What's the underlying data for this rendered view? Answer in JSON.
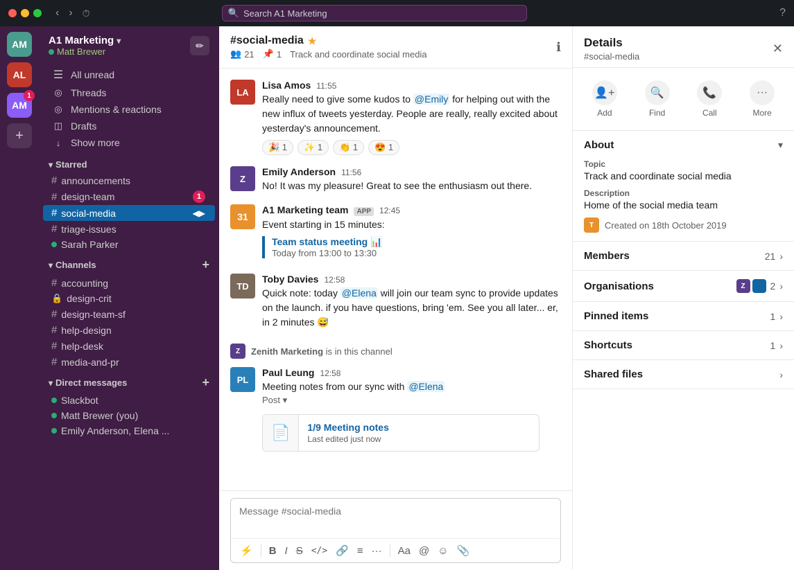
{
  "titleBar": {
    "searchPlaceholder": "Search A1 Marketing",
    "backBtn": "‹",
    "forwardBtn": "›"
  },
  "activityBar": {
    "workspaceInitials": "AM",
    "secondInitials": "AL",
    "thirdInitials": "AM",
    "badgeCount": "1"
  },
  "sidebar": {
    "workspaceName": "A1 Marketing",
    "userName": "Matt Brewer",
    "navItems": [
      {
        "id": "all-unread",
        "label": "All unread",
        "icon": "☰"
      },
      {
        "id": "threads",
        "label": "Threads",
        "icon": "○"
      },
      {
        "id": "mentions",
        "label": "Mentions & reactions",
        "icon": "○"
      },
      {
        "id": "drafts",
        "label": "Drafts",
        "icon": "◫"
      },
      {
        "id": "show-more",
        "label": "Show more",
        "icon": "↓"
      }
    ],
    "starred": {
      "title": "Starred",
      "items": [
        {
          "id": "announcements",
          "label": "announcements",
          "prefix": "#"
        },
        {
          "id": "design-team",
          "label": "design-team",
          "prefix": "#",
          "badge": "1"
        },
        {
          "id": "social-media",
          "label": "social-media",
          "prefix": "#",
          "active": true
        }
      ]
    },
    "channels": {
      "title": "Channels",
      "items": [
        {
          "id": "accounting",
          "label": "accounting",
          "prefix": "#"
        },
        {
          "id": "design-crit",
          "label": "design-crit",
          "prefix": "🔒",
          "lock": true
        },
        {
          "id": "design-team-sf",
          "label": "design-team-sf",
          "prefix": "#"
        },
        {
          "id": "help-design",
          "label": "help-design",
          "prefix": "#"
        },
        {
          "id": "help-desk",
          "label": "help-desk",
          "prefix": "#"
        },
        {
          "id": "media-and-pr",
          "label": "media-and-pr",
          "prefix": "#"
        }
      ]
    },
    "dms": {
      "title": "Direct messages",
      "items": [
        {
          "id": "slackbot",
          "label": "Slackbot",
          "status": "online"
        },
        {
          "id": "matt",
          "label": "Matt Brewer (you)",
          "status": "online"
        },
        {
          "id": "emily-elena",
          "label": "Emily Anderson, Elena ...",
          "status": "online"
        }
      ]
    },
    "extraItem": {
      "label": "Sarah Parker",
      "status": "online"
    }
  },
  "chat": {
    "channelName": "#social-media",
    "memberCount": "21",
    "pinCount": "1",
    "description": "Track and coordinate social media",
    "messages": [
      {
        "id": "msg1",
        "sender": "Lisa Amos",
        "time": "11:55",
        "avatarColor": "#c0392b",
        "avatarInitials": "LA",
        "text": "Really need to give some kudos to @Emily for helping out with the new influx of tweets yesterday. People are really, really excited about yesterday's announcement.",
        "mention": "@Emily",
        "reactions": [
          {
            "emoji": "🎉",
            "count": "1"
          },
          {
            "emoji": "✨",
            "count": "1"
          },
          {
            "emoji": "👏",
            "count": "1"
          },
          {
            "emoji": "😍",
            "count": "1"
          }
        ]
      },
      {
        "id": "msg2",
        "sender": "Emily Anderson",
        "time": "11:56",
        "avatarColor": "#5a3e8b",
        "avatarInitials": "Z",
        "text": "No! It was my pleasure! Great to see the enthusiasm out there."
      },
      {
        "id": "msg3",
        "sender": "A1 Marketing team",
        "time": "12:45",
        "isApp": true,
        "avatarNum": "31",
        "text": "Event starting in 15 minutes:",
        "quote": {
          "title": "Team status meeting 📊",
          "text": "Today from 13:00 to 13:30"
        }
      },
      {
        "id": "msg4",
        "sender": "Toby Davies",
        "time": "12:58",
        "avatarColor": "#7a6a5a",
        "avatarInitials": "TD",
        "text": "Quick note: today @Elena will join our team sync to provide updates on the launch. if you have questions, bring 'em. See you all later... er, in 2 minutes 😅",
        "mention": "@Elena"
      },
      {
        "id": "msg5",
        "sender": "Paul Leung",
        "time": "12:58",
        "avatarColor": "#2980b9",
        "avatarInitials": "PL",
        "text": "Meeting notes from our sync with @Elena",
        "mention": "@Elena",
        "postLabel": "Post",
        "post": {
          "title": "1/9 Meeting notes",
          "meta": "Last edited just now"
        }
      }
    ],
    "systemMsg": {
      "text": "Zenith Marketing is in this channel",
      "avatarLabel": "Z"
    },
    "inputPlaceholder": "Message #social-media",
    "toolbarButtons": [
      "⚡",
      "B",
      "I",
      "S",
      "</>",
      "🔗",
      "≡",
      "···",
      "Aa",
      "@",
      "☺",
      "📎"
    ]
  },
  "details": {
    "title": "Details",
    "subtitle": "#social-media",
    "actions": [
      {
        "id": "add",
        "label": "Add",
        "icon": "👤+"
      },
      {
        "id": "find",
        "label": "Find",
        "icon": "🔍"
      },
      {
        "id": "call",
        "label": "Call",
        "icon": "📞"
      },
      {
        "id": "more",
        "label": "More",
        "icon": "···"
      }
    ],
    "about": {
      "title": "About",
      "topic": {
        "label": "Topic",
        "value": "Track and coordinate social media"
      },
      "description": {
        "label": "Description",
        "value": "Home of the social media team"
      },
      "createdDate": "Created on 18th October 2019"
    },
    "members": {
      "title": "Members",
      "count": "21"
    },
    "organisations": {
      "title": "Organisations",
      "count": "2"
    },
    "pinnedItems": {
      "title": "Pinned items",
      "count": "1"
    },
    "shortcuts": {
      "title": "Shortcuts",
      "count": "1"
    },
    "sharedFiles": {
      "title": "Shared files"
    }
  }
}
